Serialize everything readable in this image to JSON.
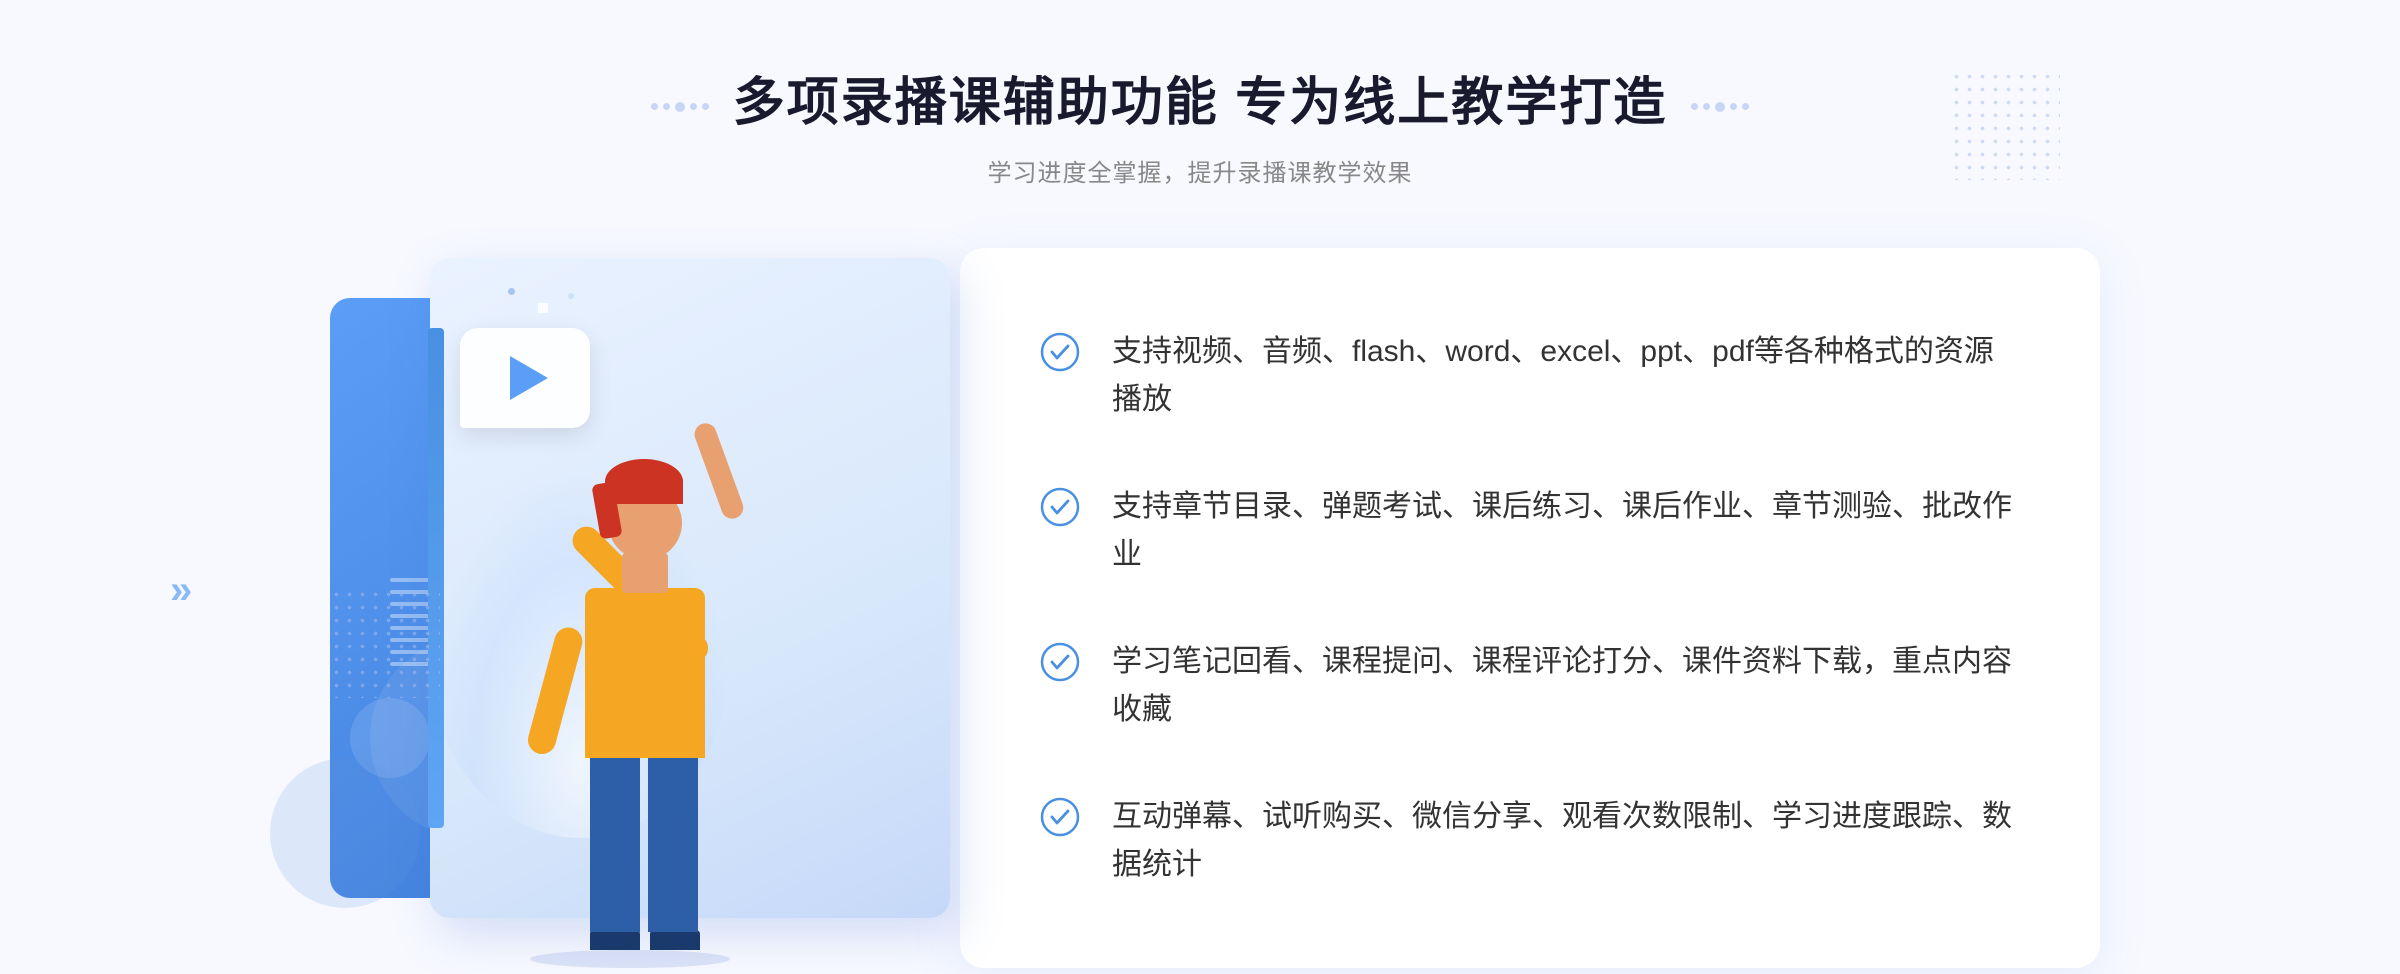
{
  "header": {
    "main_title": "多项录播课辅助功能 专为线上教学打造",
    "sub_title": "学习进度全掌握，提升录播课教学效果"
  },
  "features": [
    {
      "id": 1,
      "text": "支持视频、音频、flash、word、excel、ppt、pdf等各种格式的资源播放"
    },
    {
      "id": 2,
      "text": "支持章节目录、弹题考试、课后练习、课后作业、章节测验、批改作业"
    },
    {
      "id": 3,
      "text": "学习笔记回看、课程提问、课程评论打分、课件资料下载，重点内容收藏"
    },
    {
      "id": 4,
      "text": "互动弹幕、试听购买、微信分享、观看次数限制、学习进度跟踪、数据统计"
    }
  ],
  "decorative": {
    "chevron_left": "»",
    "dot_label": "·"
  }
}
